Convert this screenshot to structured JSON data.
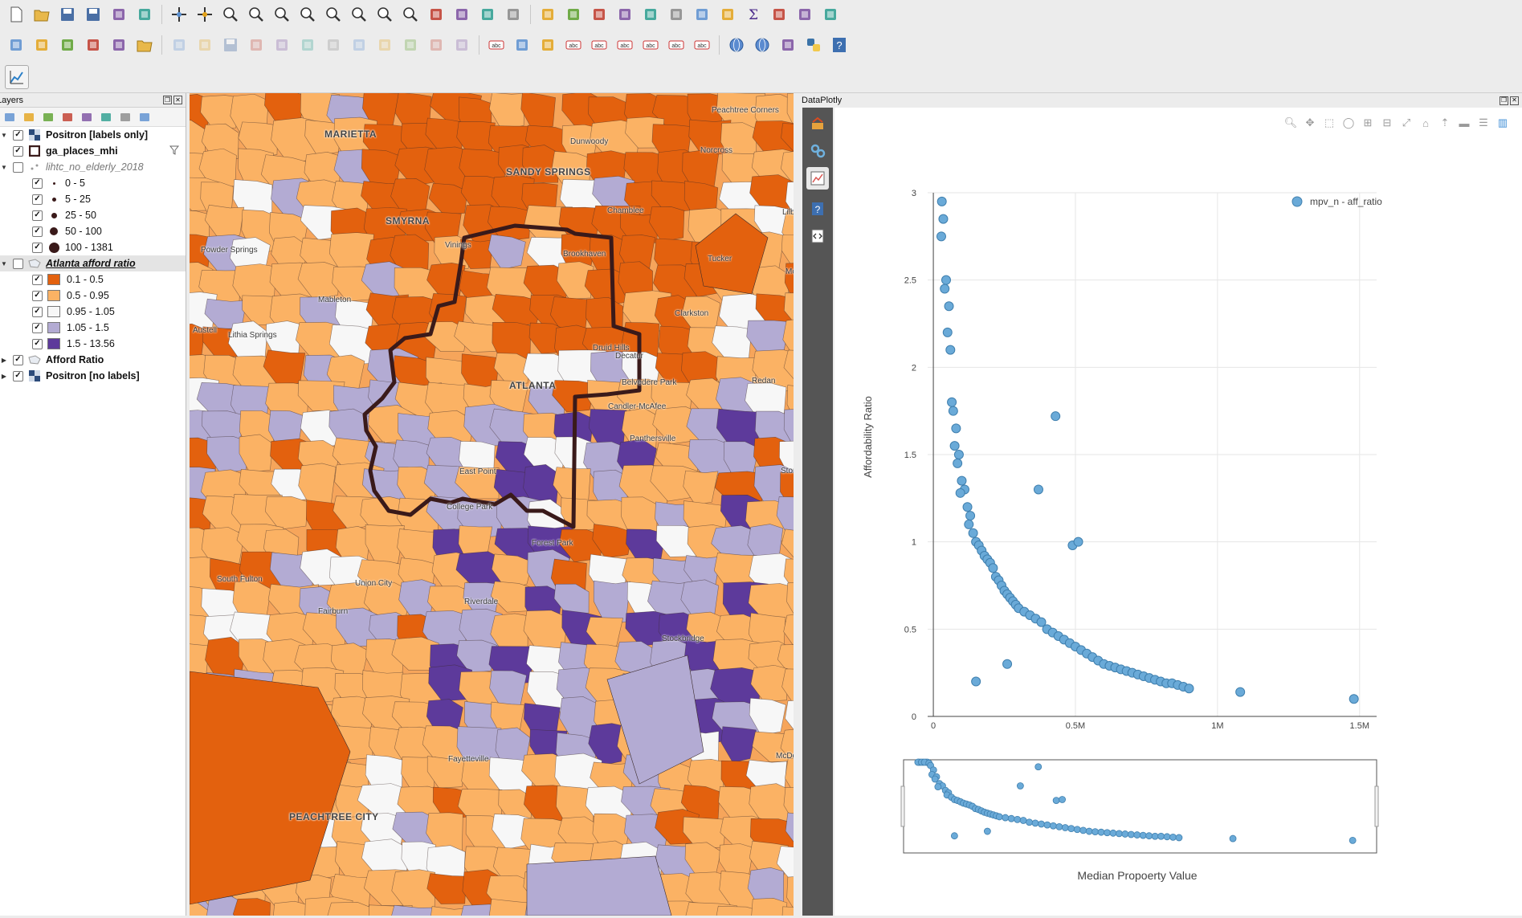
{
  "layers_panel": {
    "title": "Layers",
    "items": [
      {
        "label": "Positron [labels only]",
        "checked": true,
        "style": "bold"
      },
      {
        "label": "ga_places_mhi",
        "checked": true,
        "style": "bold"
      },
      {
        "label": "lihtc_no_elderly_2018",
        "checked": false,
        "style": "italic-gray"
      },
      {
        "label": "0 - 5",
        "checked": true
      },
      {
        "label": "5 - 25",
        "checked": true
      },
      {
        "label": "25 - 50",
        "checked": true
      },
      {
        "label": "50 - 100",
        "checked": true
      },
      {
        "label": "100 - 1381",
        "checked": true
      },
      {
        "label": "Atlanta afford ratio",
        "checked": false,
        "style": "bold-italic-underline"
      },
      {
        "label": "0.1 - 0.5",
        "checked": true,
        "color": "#e3610e"
      },
      {
        "label": "0.5 - 0.95",
        "checked": true,
        "color": "#fbb264"
      },
      {
        "label": "0.95 - 1.05",
        "checked": true,
        "color": "#f7f7f7"
      },
      {
        "label": "1.05 - 1.5",
        "checked": true,
        "color": "#b3abd3"
      },
      {
        "label": "1.5 - 13.56",
        "checked": true,
        "color": "#5d3a9b"
      },
      {
        "label": "Afford Ratio",
        "checked": true,
        "style": "bold"
      },
      {
        "label": "Positron [no labels]",
        "checked": true,
        "style": "bold"
      }
    ]
  },
  "map": {
    "places": [
      "MARIETTA",
      "SANDY SPRINGS",
      "Dunwoody",
      "Peachtree Corners",
      "Norcross",
      "Chamblee",
      "SMYRNA",
      "Vinings",
      "Brookhaven",
      "Tucker",
      "Powder Springs",
      "Mableton",
      "Lilbu",
      "Clarkston",
      "Mour",
      "Austell",
      "Lithia Springs",
      "Druid Hills",
      "Decatur",
      "ATLANTA",
      "Belvedere Park",
      "Redan",
      "Candler-McAfee",
      "Panthersville",
      "East Point",
      "Stone",
      "College Park",
      "Forest Park",
      "South Fulton",
      "Union City",
      "Fairburn",
      "Riverdale",
      "Stockbridge",
      "Fayetteville",
      "McDono",
      "PEACHTREE CITY"
    ]
  },
  "dataplotly": {
    "title": "DataPlotly",
    "legend_label": "mpv_n - aff_ratio",
    "y_axis_title": "Affordability Ratio",
    "x_axis_title": "Median Propoerty Value",
    "y_ticks": [
      "0",
      "0.5",
      "1",
      "1.5",
      "2",
      "2.5",
      "3"
    ],
    "x_ticks": [
      "0",
      "0.5M",
      "1M",
      "1.5M"
    ]
  },
  "colors": {
    "choropleth_low": "#e3610e",
    "choropleth_midlow": "#fbb264",
    "choropleth_mid": "#f7f7f7",
    "choropleth_midhigh": "#b3abd3",
    "choropleth_high": "#5d3a9b",
    "scatter_fill": "#6aaad8",
    "scatter_stroke": "#3f7fae"
  },
  "chart_data": {
    "type": "scatter",
    "title": "",
    "xlabel": "Median Propoerty Value",
    "ylabel": "Affordability Ratio",
    "xlim": [
      -20000,
      1560000
    ],
    "ylim": [
      0,
      3
    ],
    "legend": "top-right",
    "grid": true,
    "series": [
      {
        "name": "mpv_n - aff_ratio",
        "x": [
          30000,
          35000,
          28000,
          45000,
          40000,
          55000,
          60000,
          50000,
          65000,
          70000,
          80000,
          75000,
          90000,
          85000,
          100000,
          110000,
          95000,
          120000,
          130000,
          125000,
          140000,
          150000,
          160000,
          170000,
          180000,
          190000,
          200000,
          210000,
          220000,
          230000,
          240000,
          250000,
          260000,
          270000,
          280000,
          290000,
          300000,
          320000,
          340000,
          360000,
          380000,
          400000,
          420000,
          440000,
          460000,
          480000,
          500000,
          520000,
          540000,
          560000,
          580000,
          600000,
          620000,
          640000,
          660000,
          680000,
          700000,
          720000,
          740000,
          760000,
          780000,
          800000,
          820000,
          840000,
          860000,
          880000,
          900000,
          1080000,
          1480000,
          370000,
          430000,
          490000,
          510000,
          150000,
          260000
        ],
        "y": [
          2.95,
          2.85,
          2.75,
          2.5,
          2.45,
          2.35,
          2.1,
          2.2,
          1.8,
          1.75,
          1.65,
          1.55,
          1.5,
          1.45,
          1.35,
          1.3,
          1.28,
          1.2,
          1.15,
          1.1,
          1.05,
          1.0,
          0.98,
          0.95,
          0.92,
          0.9,
          0.88,
          0.85,
          0.8,
          0.78,
          0.75,
          0.72,
          0.7,
          0.68,
          0.66,
          0.64,
          0.62,
          0.6,
          0.58,
          0.56,
          0.54,
          0.5,
          0.48,
          0.46,
          0.44,
          0.42,
          0.4,
          0.38,
          0.36,
          0.34,
          0.32,
          0.3,
          0.29,
          0.28,
          0.27,
          0.26,
          0.25,
          0.24,
          0.23,
          0.22,
          0.21,
          0.2,
          0.19,
          0.19,
          0.18,
          0.17,
          0.16,
          0.14,
          0.1,
          1.3,
          1.72,
          0.98,
          1.0,
          0.2,
          0.3
        ]
      }
    ]
  }
}
